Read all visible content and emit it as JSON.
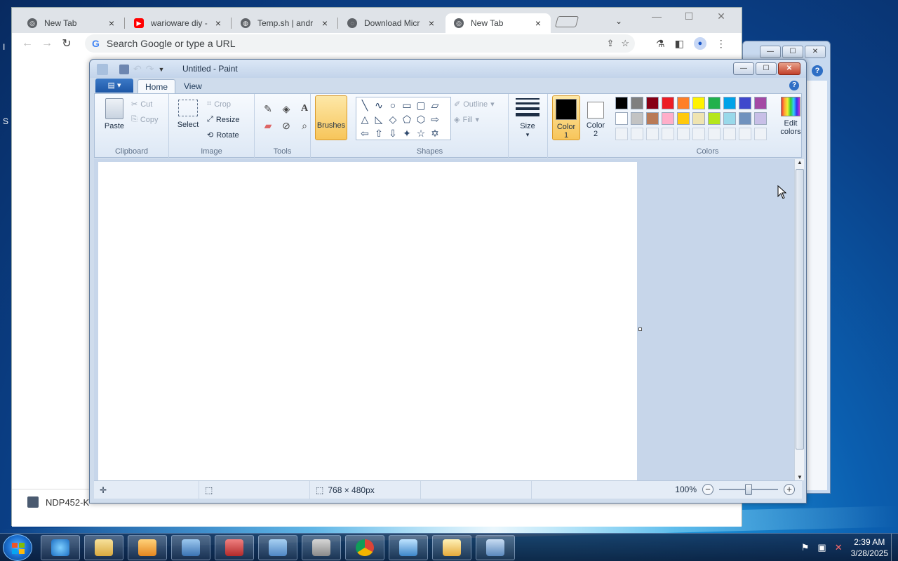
{
  "chrome": {
    "tabs": [
      {
        "title": "New Tab",
        "color": "#5f6368"
      },
      {
        "title": "warioware diy -",
        "color": "#ff0000"
      },
      {
        "title": "Temp.sh | andr",
        "color": "#5f6368"
      },
      {
        "title": "Download Micr",
        "color": "#5f6368"
      },
      {
        "title": "New Tab",
        "color": "#5f6368"
      }
    ],
    "omnibox_placeholder": "Search Google or type a URL",
    "google_glyph": "G",
    "download_item": "NDP452-K"
  },
  "paint": {
    "title": "Untitled - Paint",
    "file_menu": "▤ ▾",
    "tabs": {
      "home": "Home",
      "view": "View"
    },
    "help": "?",
    "clipboard": {
      "paste": "Paste",
      "cut": "Cut",
      "copy": "Copy",
      "group": "Clipboard"
    },
    "image": {
      "select": "Select",
      "crop": "Crop",
      "resize": "Resize",
      "rotate": "Rotate",
      "group": "Image"
    },
    "tools": {
      "group": "Tools",
      "text_glyph": "A"
    },
    "brushes": "Brushes",
    "shapes": {
      "outline": "Outline",
      "fill": "Fill",
      "group": "Shapes"
    },
    "size": "Size",
    "color1": {
      "label": "Color",
      "num": "1",
      "value": "#000000"
    },
    "color2": {
      "label": "Color",
      "num": "2",
      "value": "#ffffff"
    },
    "colors_group": "Colors",
    "edit_colors": {
      "line1": "Edit",
      "line2": "colors"
    },
    "palette": [
      "#000000",
      "#7f7f7f",
      "#880015",
      "#ed1c24",
      "#ff7f27",
      "#fff200",
      "#22b14c",
      "#00a2e8",
      "#3f48cc",
      "#a349a4",
      "#ffffff",
      "#c3c3c3",
      "#b97a57",
      "#ffaec9",
      "#ffc90e",
      "#efe4b0",
      "#b5e61d",
      "#99d9ea",
      "#7092be",
      "#c8bfe7"
    ],
    "status": {
      "dimensions": "768 × 480px",
      "zoom": "100%"
    }
  },
  "taskbar": {
    "time": "2:39 AM",
    "date": "3/28/2025"
  },
  "window_controls": {
    "min": "—",
    "max": "☐",
    "close": "✕"
  }
}
